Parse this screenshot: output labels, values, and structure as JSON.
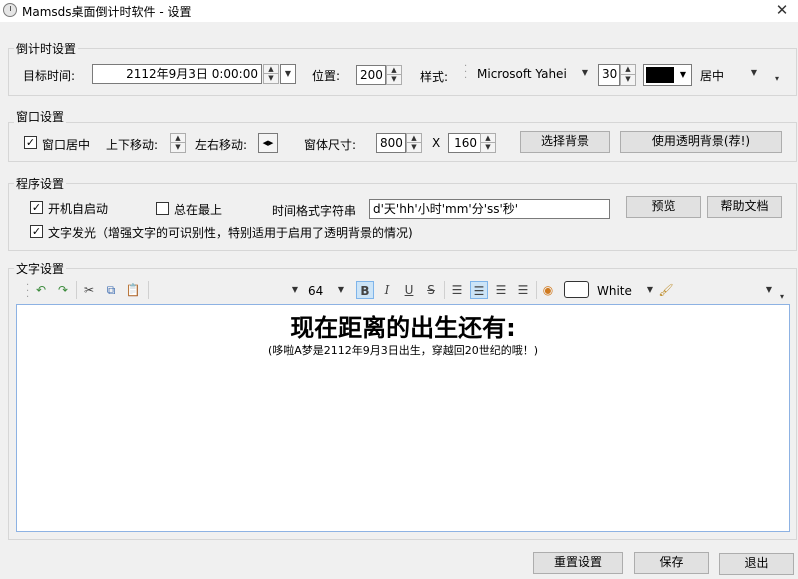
{
  "window": {
    "title": "Mamsds桌面倒计时软件 - 设置",
    "close_glyph": "✕"
  },
  "countdown": {
    "group_title": "倒计时设置",
    "target_label": "目标时间:",
    "target_value": "2112年9月3日 0:00:00",
    "position_label": "位置:",
    "position_value": "200",
    "style_label": "样式:",
    "font_value": "Microsoft Yahei",
    "size_value": "30",
    "color_value": "#000000",
    "align_value": "居中"
  },
  "window_settings": {
    "group_title": "窗口设置",
    "center_label": "窗口居中",
    "center_checked": true,
    "updown_label": "上下移动:",
    "leftright_label": "左右移动:",
    "size_label": "窗体尺寸:",
    "width_value": "800",
    "x_label": "X",
    "height_value": "160",
    "choose_bg_label": "选择背景",
    "transparent_bg_label": "使用透明背景(荐!)"
  },
  "program": {
    "group_title": "程序设置",
    "autostart_label": "开机自启动",
    "autostart_checked": true,
    "topmost_label": "总在最上",
    "topmost_checked": false,
    "format_label": "时间格式字符串",
    "format_value": "d'天'hh'小时'mm'分'ss'秒'",
    "preview_label": "预览",
    "help_label": "帮助文档",
    "glow_label": "文字发光（增强文字的可识别性，特别适用于启用了透明背景的情况)",
    "glow_checked": true
  },
  "text_settings": {
    "group_title": "文字设置",
    "font_size": "64",
    "color_name": "White",
    "editor_heading": "现在距离的出生还有:",
    "editor_sub": "(哆啦A梦是2112年9月3日出生，穿越回20世纪的哦！)"
  },
  "footer": {
    "reset_label": "重置设置",
    "save_label": "保存",
    "exit_label": "退出"
  },
  "colors": {
    "editor_border": "#8db2e3",
    "bold_active": "#cce4f7"
  }
}
